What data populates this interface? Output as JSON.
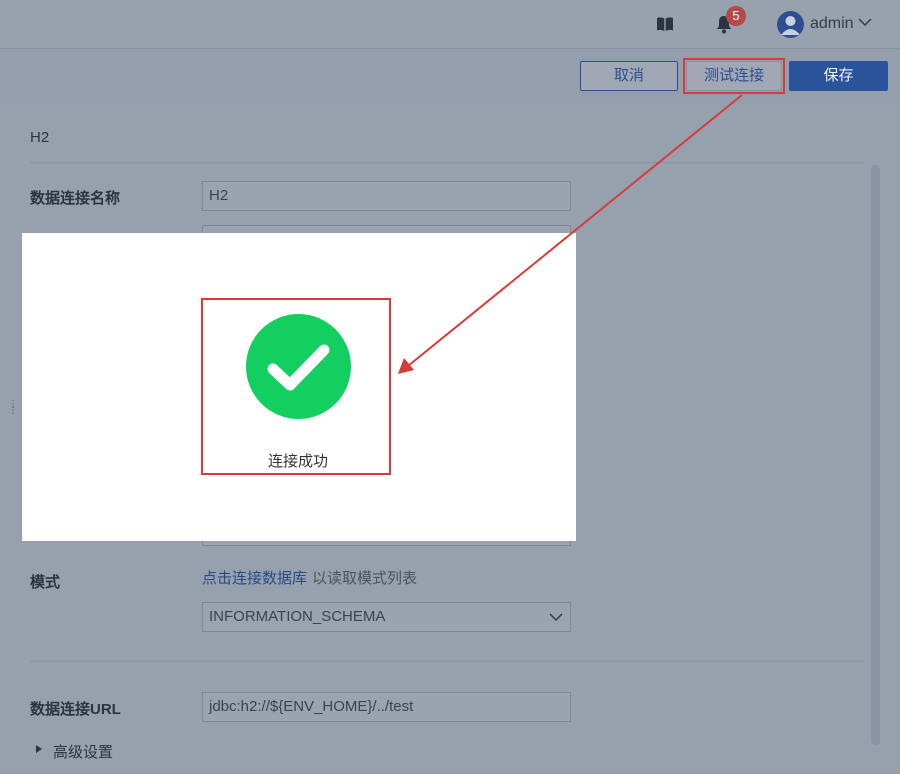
{
  "header": {
    "notification_count": "5",
    "username": "admin",
    "icons": [
      "book-icon",
      "bell-icon",
      "user-avatar-icon",
      "chevron-down-icon"
    ]
  },
  "toolbar": {
    "cancel_label": "取消",
    "test_label": "测试连接",
    "save_label": "保存"
  },
  "form": {
    "title": "H2",
    "connection_name_label": "数据连接名称",
    "connection_name_value": "H2",
    "schema_label": "模式",
    "schema_link": "点击连接数据库",
    "schema_hint": "以读取模式列表",
    "schema_value": "INFORMATION_SCHEMA",
    "url_label": "数据连接URL",
    "url_value": "jdbc:h2://${ENV_HOME}/../test",
    "advanced_label": "高级设置"
  },
  "dialog": {
    "message": "连接成功"
  },
  "colors": {
    "success": "#13cf60",
    "primary": "#2a539c",
    "annotation": "#d93a3a"
  }
}
